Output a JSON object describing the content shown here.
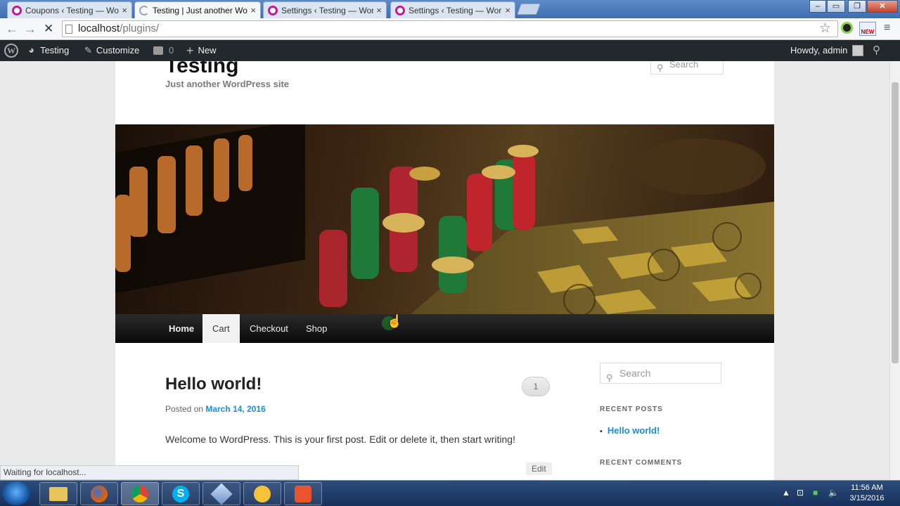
{
  "browser": {
    "tabs": [
      {
        "label": "Coupons ‹ Testing — Wor",
        "active": false
      },
      {
        "label": "Testing | Just another Wo",
        "active": true
      },
      {
        "label": "Settings ‹ Testing — Wor",
        "active": false
      },
      {
        "label": "Settings ‹ Testing — Wor",
        "active": false
      }
    ],
    "url_host": "localhost",
    "url_path": "/plugins/",
    "status_text": "Waiting for localhost..."
  },
  "adminbar": {
    "site_name": "Testing",
    "customize": "Customize",
    "comments_count": "0",
    "new_label": "New",
    "howdy": "Howdy, admin"
  },
  "site": {
    "title": "Testing",
    "description": "Just another WordPress site",
    "search_placeholder": "Search"
  },
  "menu": {
    "items": [
      "Home",
      "Cart",
      "Checkout",
      "Shop"
    ]
  },
  "post": {
    "title": "Hello world!",
    "posted_on": "Posted on",
    "date": "March 14, 2016",
    "comment_count": "1",
    "body": "Welcome to WordPress. This is your first post. Edit or delete it, then start writing!",
    "edit": "Edit"
  },
  "sidebar": {
    "search_placeholder": "Search",
    "recent_posts_title": "RECENT POSTS",
    "recent_posts": [
      "Hello world!"
    ],
    "recent_comments_title": "RECENT COMMENTS"
  },
  "taskbar": {
    "time": "11:56 AM",
    "date": "3/15/2016"
  }
}
